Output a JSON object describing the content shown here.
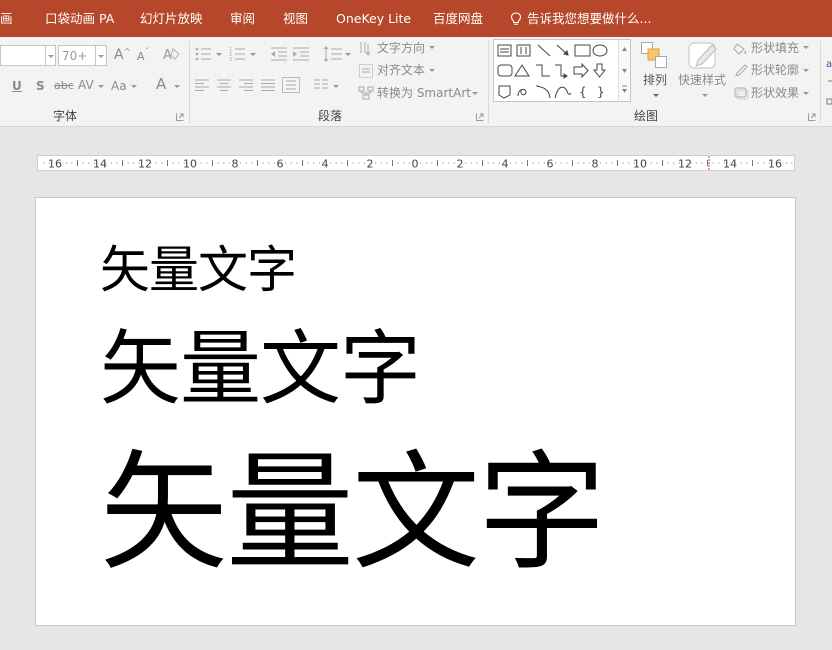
{
  "menu": {
    "items": [
      "画",
      "口袋动画 PA",
      "幻灯片放映",
      "审阅",
      "视图",
      "OneKey Lite",
      "百度网盘"
    ],
    "tell_me": "告诉我您想要做什么..."
  },
  "ribbon": {
    "font": {
      "size_value": "70+",
      "grow": "A",
      "shrink": "A",
      "underline": "U",
      "shadow": "S",
      "strike": "abc",
      "spacing": "AV",
      "case": "Aa",
      "color": "A",
      "label": "字体"
    },
    "paragraph": {
      "text_direction": "文字方向",
      "align_text": "对齐文本",
      "smartart": "转换为 SmartArt",
      "label": "段落"
    },
    "drawing": {
      "arrange": "排列",
      "quick_styles": "快速样式",
      "shape_fill": "形状填充",
      "shape_outline": "形状轮廓",
      "shape_effects": "形状效果",
      "label": "绘图"
    }
  },
  "ruler": {
    "labels": [
      "16",
      "14",
      "12",
      "10",
      "8",
      "6",
      "4",
      "2",
      "0",
      "2",
      "4",
      "6",
      "8",
      "10",
      "12",
      "14",
      "16"
    ]
  },
  "slide": {
    "text_small": "矢量文字",
    "text_medium": "矢量文字",
    "text_large": "矢量文字"
  }
}
